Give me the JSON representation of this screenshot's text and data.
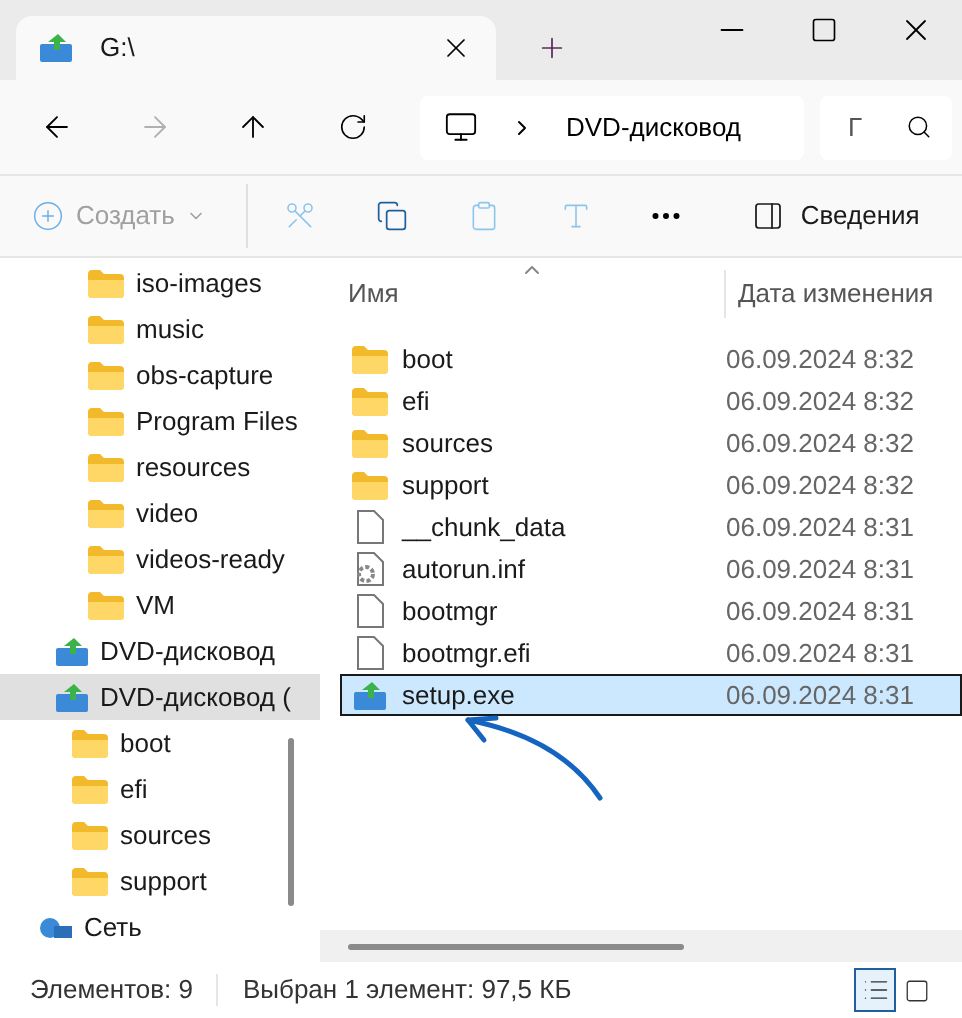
{
  "window": {
    "tab_title": "G:\\"
  },
  "address": {
    "crumb": "DVD-дисковод",
    "search_placeholder": "Г"
  },
  "toolbar": {
    "new_label": "Создать",
    "details_label": "Сведения"
  },
  "sidebar": {
    "items": [
      {
        "kind": "continuation",
        "children": [
          {
            "kind": "folder",
            "label": "iso-images",
            "selected": false
          },
          {
            "kind": "folder",
            "label": "music",
            "selected": false
          },
          {
            "kind": "folder",
            "label": "obs-capture",
            "selected": false
          },
          {
            "kind": "folder",
            "label": "Program Files",
            "selected": false
          },
          {
            "kind": "folder",
            "label": "resources",
            "selected": false
          },
          {
            "kind": "folder",
            "label": "video",
            "selected": false
          },
          {
            "kind": "folder",
            "label": "videos-ready",
            "selected": false
          },
          {
            "kind": "folder",
            "label": "VM",
            "selected": false
          }
        ]
      },
      {
        "kind": "drive",
        "label": "DVD-дисковод",
        "selected": false
      },
      {
        "kind": "drive",
        "label": "DVD-дисковод (",
        "selected": true,
        "children": [
          {
            "kind": "folder",
            "label": "boot",
            "selected": false
          },
          {
            "kind": "folder",
            "label": "efi",
            "selected": false
          },
          {
            "kind": "folder",
            "label": "sources",
            "selected": false
          },
          {
            "kind": "folder",
            "label": "support",
            "selected": false
          }
        ]
      },
      {
        "kind": "network",
        "label": "Сеть",
        "selected": false
      }
    ]
  },
  "table": {
    "columns": [
      "Имя",
      "Дата изменения"
    ],
    "rows": [
      {
        "kind": "folder",
        "name": "boot",
        "date": "06.09.2024 8:32",
        "selected": false
      },
      {
        "kind": "folder",
        "name": "efi",
        "date": "06.09.2024 8:32",
        "selected": false
      },
      {
        "kind": "folder",
        "name": "sources",
        "date": "06.09.2024 8:32",
        "selected": false
      },
      {
        "kind": "folder",
        "name": "support",
        "date": "06.09.2024 8:32",
        "selected": false
      },
      {
        "kind": "file",
        "name": "__chunk_data",
        "date": "06.09.2024 8:31",
        "selected": false
      },
      {
        "kind": "settings",
        "name": "autorun.inf",
        "date": "06.09.2024 8:31",
        "selected": false
      },
      {
        "kind": "file",
        "name": "bootmgr",
        "date": "06.09.2024 8:31",
        "selected": false
      },
      {
        "kind": "file",
        "name": "bootmgr.efi",
        "date": "06.09.2024 8:31",
        "selected": false
      },
      {
        "kind": "setup",
        "name": "setup.exe",
        "date": "06.09.2024 8:31",
        "selected": true
      }
    ]
  },
  "status_bar": {
    "count": "Элементов: 9",
    "selection": "Выбран 1 элемент: 97,5 КБ",
    "details_view_selected": true
  }
}
